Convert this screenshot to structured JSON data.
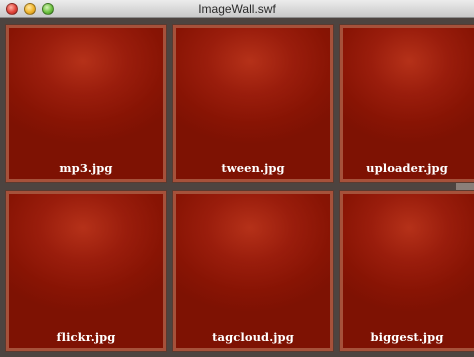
{
  "window": {
    "title": "ImageWall.swf"
  },
  "tiles": [
    {
      "label": "mp3.jpg"
    },
    {
      "label": "tween.jpg"
    },
    {
      "label": "uploader.jpg"
    },
    {
      "label": "flickr.jpg"
    },
    {
      "label": "tagcloud.jpg"
    },
    {
      "label": "biggest.jpg"
    }
  ]
}
